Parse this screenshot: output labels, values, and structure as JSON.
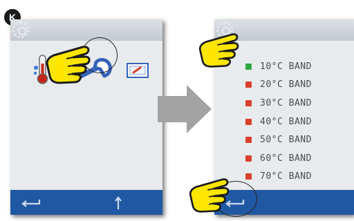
{
  "step": {
    "letter": "K"
  },
  "colors": {
    "screen_bg": "#e8ebed",
    "bottombar": "#2158a4",
    "band_active": "#2da843",
    "band_inactive": "#d8402b",
    "hand": "#ffe600",
    "arrow": "#a3a3a3"
  },
  "left_screen": {
    "icons": [
      "gear-icon",
      "thermometer-icon",
      "wrench-icon",
      "display-settings-icon"
    ],
    "bottom_icons": [
      "back-arrow-icon",
      "up-arrow-icon"
    ]
  },
  "right_screen": {
    "bands": [
      {
        "label": "10°C BAND",
        "active": true
      },
      {
        "label": "20°C BAND",
        "active": false
      },
      {
        "label": "30°C BAND",
        "active": false
      },
      {
        "label": "40°C BAND",
        "active": false
      },
      {
        "label": "50°C BAND",
        "active": false
      },
      {
        "label": "60°C BAND",
        "active": false
      },
      {
        "label": "70°C BAND",
        "active": false
      }
    ],
    "bottom_icons": [
      "back-arrow-icon"
    ]
  }
}
